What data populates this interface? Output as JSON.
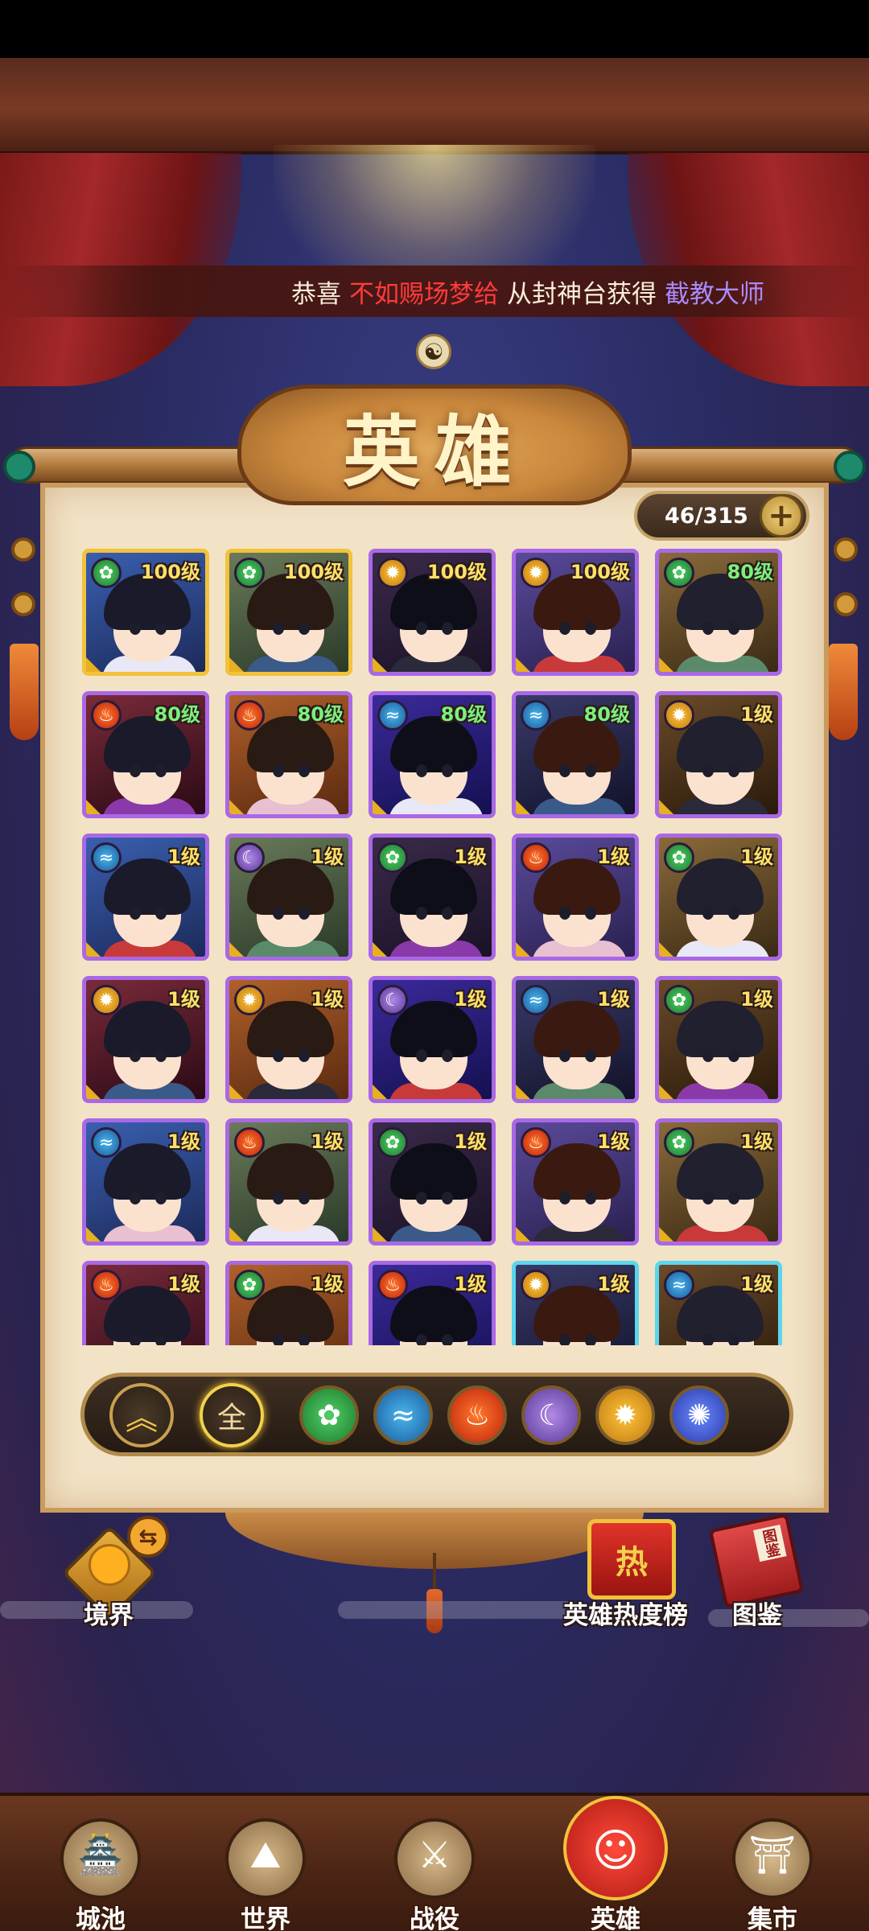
{
  "announcement": {
    "prefix": "恭喜",
    "player": "不如赐场梦给",
    "middle": "从封神台获得",
    "item": "截教大师"
  },
  "title": "英雄",
  "counter": {
    "value": "46/315",
    "plus": "+"
  },
  "colors": {
    "gold_frame": "#f2c23a",
    "purple_frame": "#a968e6",
    "cyan_frame": "#5ad6ee",
    "level_high": "#ffe066",
    "level_mid": "#7cf07c",
    "level_low": "#ffe066"
  },
  "heroes": [
    {
      "level": "100级",
      "element": "wood",
      "frame": "gold"
    },
    {
      "level": "100级",
      "element": "wood",
      "frame": "gold"
    },
    {
      "level": "100级",
      "element": "sun",
      "frame": "purple"
    },
    {
      "level": "100级",
      "element": "sun",
      "frame": "purple"
    },
    {
      "level": "80级",
      "element": "wood",
      "frame": "purple"
    },
    {
      "level": "80级",
      "element": "fire",
      "frame": "purple"
    },
    {
      "level": "80级",
      "element": "fire",
      "frame": "purple"
    },
    {
      "level": "80级",
      "element": "water",
      "frame": "purple"
    },
    {
      "level": "80级",
      "element": "water",
      "frame": "purple"
    },
    {
      "level": "1级",
      "element": "sun",
      "frame": "purple"
    },
    {
      "level": "1级",
      "element": "water",
      "frame": "purple"
    },
    {
      "level": "1级",
      "element": "moon",
      "frame": "purple"
    },
    {
      "level": "1级",
      "element": "wood",
      "frame": "purple"
    },
    {
      "level": "1级",
      "element": "fire",
      "frame": "purple"
    },
    {
      "level": "1级",
      "element": "wood",
      "frame": "purple"
    },
    {
      "level": "1级",
      "element": "sun",
      "frame": "purple"
    },
    {
      "level": "1级",
      "element": "sun",
      "frame": "purple"
    },
    {
      "level": "1级",
      "element": "moon",
      "frame": "purple"
    },
    {
      "level": "1级",
      "element": "water",
      "frame": "purple"
    },
    {
      "level": "1级",
      "element": "wood",
      "frame": "purple"
    },
    {
      "level": "1级",
      "element": "water",
      "frame": "purple"
    },
    {
      "level": "1级",
      "element": "fire",
      "frame": "purple"
    },
    {
      "level": "1级",
      "element": "wood",
      "frame": "purple"
    },
    {
      "level": "1级",
      "element": "fire",
      "frame": "purple"
    },
    {
      "level": "1级",
      "element": "wood",
      "frame": "purple"
    },
    {
      "level": "1级",
      "element": "fire",
      "frame": "purple"
    },
    {
      "level": "1级",
      "element": "wood",
      "frame": "purple"
    },
    {
      "level": "1级",
      "element": "fire",
      "frame": "purple"
    },
    {
      "level": "1级",
      "element": "sun",
      "frame": "cyan"
    },
    {
      "level": "1级",
      "element": "water",
      "frame": "cyan"
    }
  ],
  "filters": {
    "sort_icon": "double-chevron-up-icon",
    "all_label": "全",
    "elements": [
      "wood",
      "water",
      "fire",
      "moon",
      "sun",
      "vortex"
    ]
  },
  "side": {
    "realm_label": "境界",
    "ranking_label": "英雄热度榜",
    "ranking_badge": "热",
    "codex_label": "图鉴",
    "codex_badge": "图鉴"
  },
  "nav": [
    {
      "label": "城池",
      "icon": "city-icon"
    },
    {
      "label": "世界",
      "icon": "world-icon"
    },
    {
      "label": "战役",
      "icon": "battle-icon"
    },
    {
      "label": "英雄",
      "icon": "hero-icon",
      "active": true
    },
    {
      "label": "集市",
      "icon": "market-icon"
    }
  ]
}
